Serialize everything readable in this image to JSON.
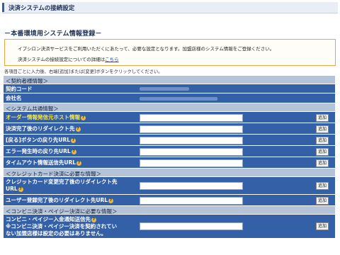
{
  "page": {
    "title": "決済システムの接続設定",
    "section_title": "－本番環境用システム情報登録－",
    "notice": {
      "line1": "イプシロン決済サービスをご利用いただくにあたって、必要な設定となります。加盟店様のシステム情報をご登録ください。",
      "line2_prefix": "決済システムの接続設定についての詳細は",
      "line2_link": "こちら"
    },
    "instruction": "各項目ごとに入力後、右端[追加]または[変更]ボタンをクリックしてください。"
  },
  "form": {
    "add_label": "追加",
    "sections": {
      "contract": "＜契約者様情報＞",
      "system": "＜システム共通情報＞",
      "credit": "＜クレジットカード決済に必要な情報＞",
      "conveni": "＜コンビニ決済・ペイジー決済に必要な情報＞"
    },
    "fields": {
      "contract_code": "契約コード",
      "company_name": "会社名",
      "order_host": "オーダー情報発信元ホスト情報",
      "redirect_after": "決済完了後のリダイレクト先",
      "back_url": "[戻る]ボタンの戻り先URL",
      "error_url": "エラー発生時の戻り先URL",
      "timeout_url": "タイムアウト情報送信先URL",
      "card_change_redirect_1": "クレジットカード変更完了後のリダイレクト先",
      "card_change_redirect_2": "URL",
      "user_reg_redirect": "ユーザー登録完了後のリダイレクト先URL",
      "conveni_notify": "コンビニ・ペイジー入金通知送信先",
      "conveni_note_1": "※コンビニ決済・ペイジー決済を契約されてい",
      "conveni_note_2": "ない加盟店様は設定の必要はありません。"
    }
  }
}
